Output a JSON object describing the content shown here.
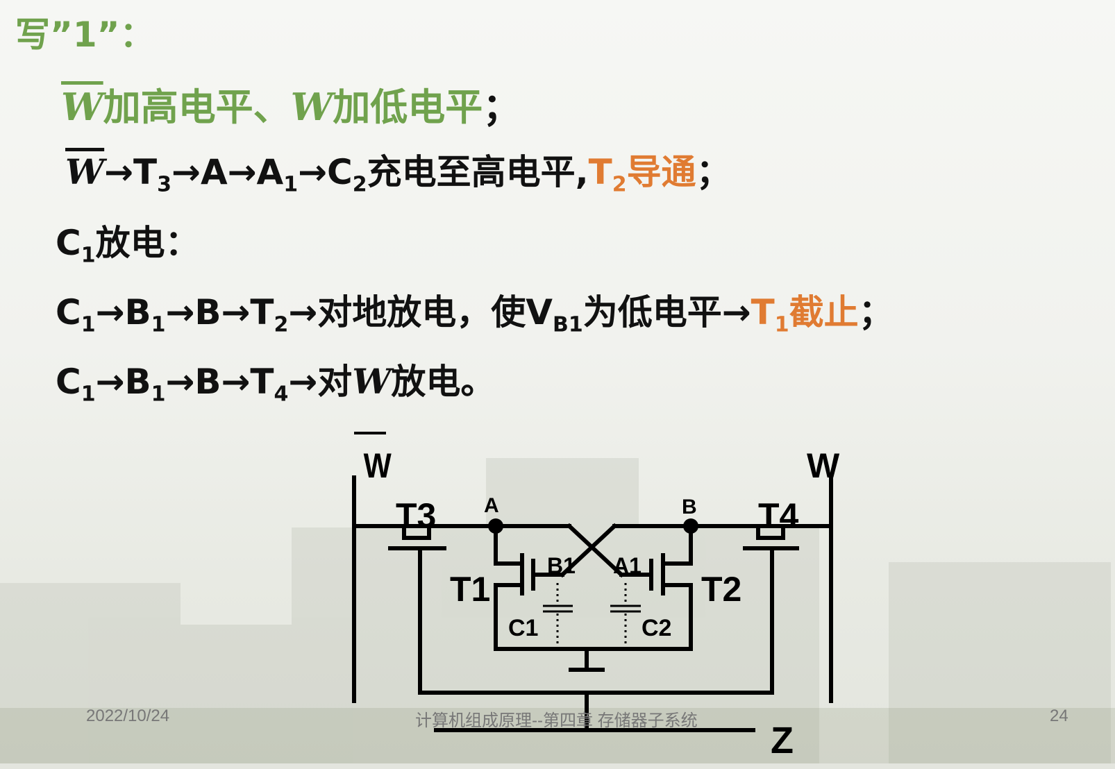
{
  "header": {
    "write_one": "写”1”："
  },
  "lines": {
    "l1": {
      "w_bar": "W",
      "text_a": "加高电平、",
      "w": "W",
      "text_b": "加低电平",
      "end": "；"
    },
    "l2": {
      "w_bar": "W",
      "t3": "→T",
      "t3_sub": "3",
      "a": "→A→A",
      "a_sub": "1",
      "c": "→C",
      "c_sub": "2",
      "text": "充电至高电平,",
      "t2": "T",
      "t2_sub": "2",
      "t2_text": "导通",
      "end": "；"
    },
    "l3": {
      "c": "C",
      "c_sub": "1",
      "text": "放电："
    },
    "l4": {
      "c": "C",
      "c_sub": "1",
      "b1": "→B",
      "b1_sub": "1",
      "b": "→B→T",
      "t_sub": "2",
      "text": "→对地放电，使V",
      "v_sub": "B1",
      "text2": "为低电平→",
      "t1": "T",
      "t1_sub": "1",
      "t1_text": "截止",
      "end": "；"
    },
    "l5": {
      "c": "C",
      "c_sub": "1",
      "b1": "→B",
      "b1_sub": "1",
      "b": "→B→T",
      "t_sub": "4",
      "text": "→对",
      "w": "W",
      "text2": "放电。"
    }
  },
  "circuit": {
    "w_bar_label": "W",
    "w_label": "W",
    "t3": "T3",
    "t4": "T4",
    "t1": "T1",
    "t2": "T2",
    "a": "A",
    "b": "B",
    "a1": "A1",
    "b1": "B1",
    "c1": "C1",
    "c2": "C2",
    "z": "Z"
  },
  "footer": {
    "date": "2022/10/24",
    "title": "计算机组成原理--第四章 存储器子系统",
    "page": "24"
  },
  "colors": {
    "green": "#70a24d",
    "orange": "#e07b32"
  }
}
